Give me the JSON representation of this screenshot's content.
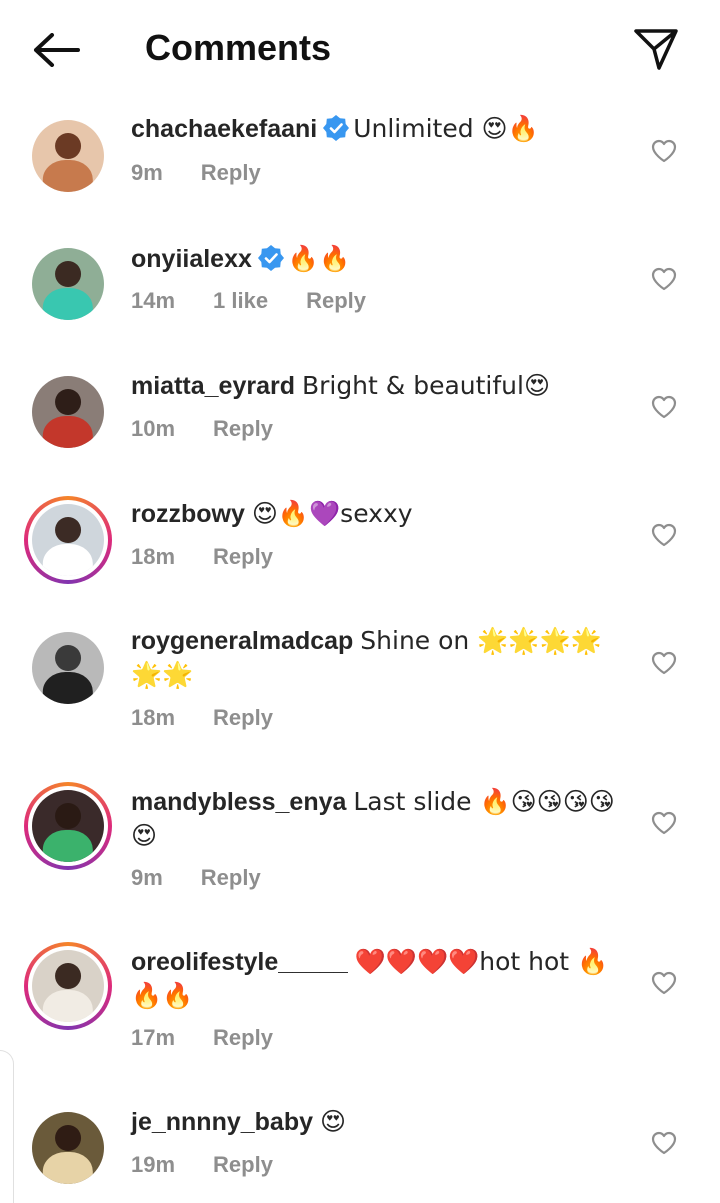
{
  "header": {
    "title": "Comments"
  },
  "comments": [
    {
      "username": "chachaekefaani",
      "verified": true,
      "text": "Unlimited 😍🔥",
      "time": "9m",
      "likes": "",
      "reply": "Reply",
      "ring": false,
      "avatar_bg": "#e7c6ab",
      "avatar_head": "#6b3a24",
      "avatar_body": "#c77a4d"
    },
    {
      "username": "onyiialexx",
      "verified": true,
      "text": "🔥🔥",
      "time": "14m",
      "likes": "1 like",
      "reply": "Reply",
      "ring": false,
      "avatar_bg": "#8fae96",
      "avatar_head": "#3b2a22",
      "avatar_body": "#39c7b0"
    },
    {
      "username": "miatta_eyrard",
      "verified": false,
      "text": "Bright & beautiful😍",
      "time": "10m",
      "likes": "",
      "reply": "Reply",
      "ring": false,
      "avatar_bg": "#8a7d77",
      "avatar_head": "#2e1e18",
      "avatar_body": "#c3372b"
    },
    {
      "username": "rozzbowy",
      "verified": false,
      "text": "😍🔥💜sexxy",
      "time": "18m",
      "likes": "",
      "reply": "Reply",
      "ring": true,
      "avatar_bg": "#cfd6dc",
      "avatar_head": "#3c2b25",
      "avatar_body": "#ffffff"
    },
    {
      "username": "roygeneralmadcap",
      "verified": false,
      "text": "Shine on 🌟🌟🌟🌟🌟🌟",
      "time": "18m",
      "likes": "",
      "reply": "Reply",
      "ring": false,
      "avatar_bg": "#b9b9b9",
      "avatar_head": "#3a3a3a",
      "avatar_body": "#202020"
    },
    {
      "username": "mandybless_enya",
      "verified": false,
      "text": "Last slide 🔥😘😘😘😘😍",
      "time": "9m",
      "likes": "",
      "reply": "Reply",
      "ring": true,
      "avatar_bg": "#3a2a2a",
      "avatar_head": "#2a1a14",
      "avatar_body": "#3bb26c"
    },
    {
      "username": "oreolifestyle_____",
      "verified": false,
      "text": "❤️❤️❤️❤️hot hot 🔥🔥🔥",
      "time": "17m",
      "likes": "",
      "reply": "Reply",
      "ring": true,
      "avatar_bg": "#d9d2c8",
      "avatar_head": "#3b2a22",
      "avatar_body": "#f1ece4"
    },
    {
      "username": "je_nnnny_baby",
      "verified": false,
      "text": "😍",
      "time": "19m",
      "likes": "",
      "reply": "Reply",
      "ring": false,
      "avatar_bg": "#6a5a3a",
      "avatar_head": "#2f1c14",
      "avatar_body": "#e7d3a7"
    }
  ],
  "icons": {
    "back": "arrow-left-icon",
    "send": "paper-plane-icon",
    "like": "heart-outline-icon",
    "verified": "verified-badge-icon"
  },
  "colors": {
    "verified": "#3897f0",
    "meta": "#8e8e8e"
  }
}
